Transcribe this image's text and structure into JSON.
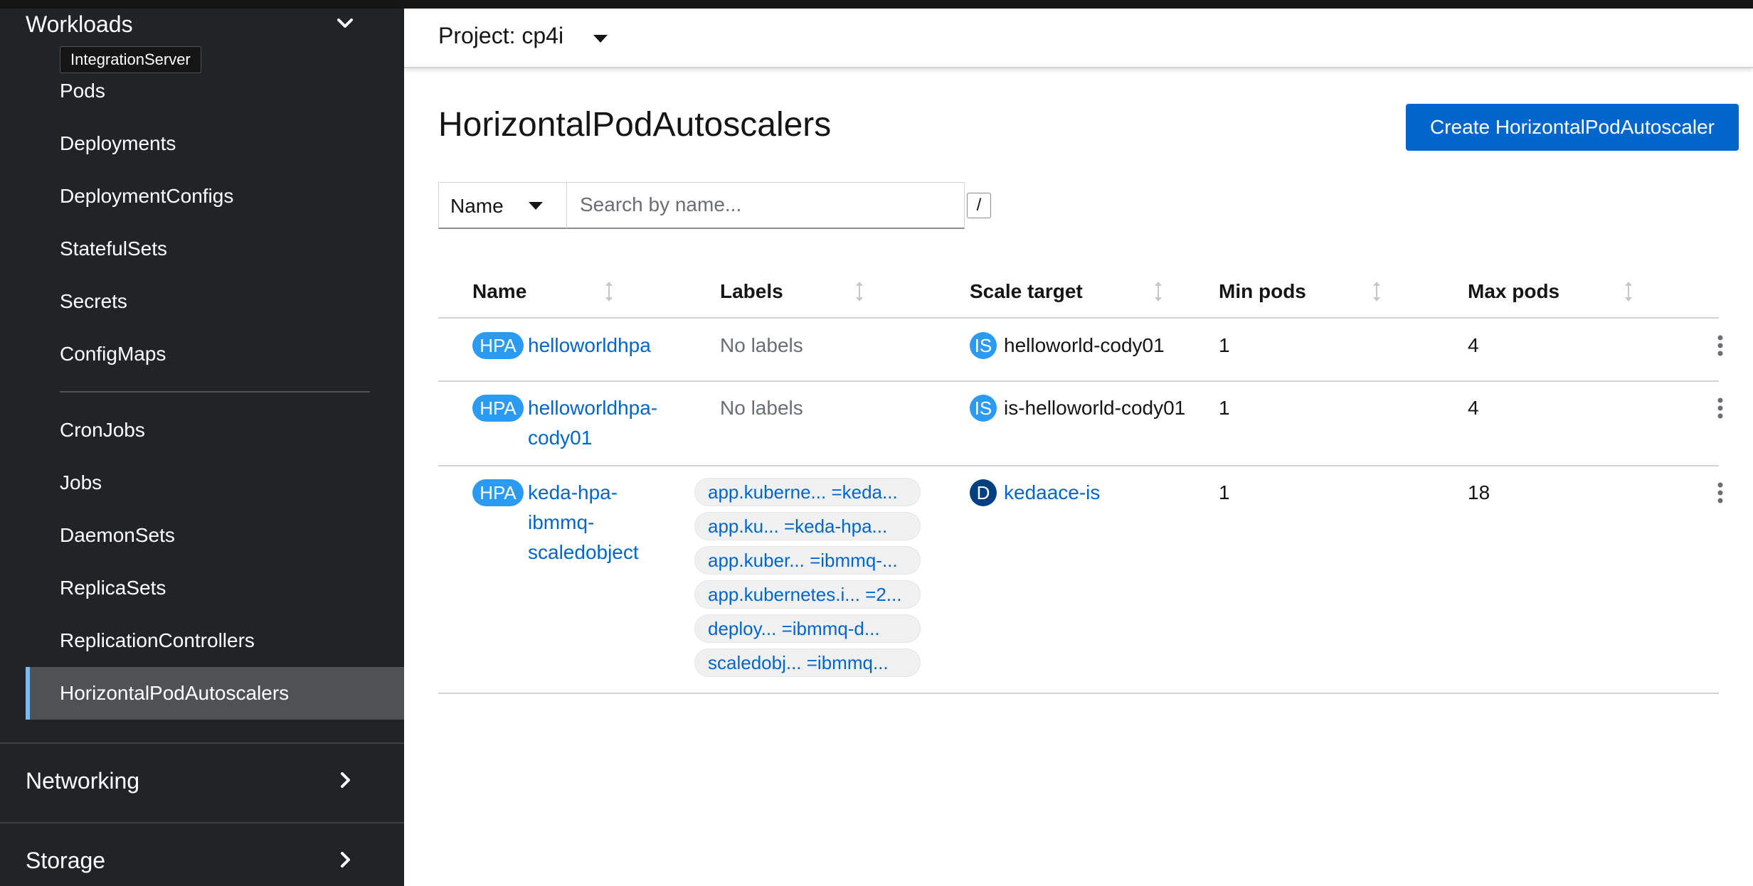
{
  "sidebar": {
    "workloads_title": "Workloads",
    "tooltip": "IntegrationServer",
    "items": [
      {
        "label": "Pods"
      },
      {
        "label": "Deployments"
      },
      {
        "label": "DeploymentConfigs"
      },
      {
        "label": "StatefulSets"
      },
      {
        "label": "Secrets"
      },
      {
        "label": "ConfigMaps"
      },
      {
        "label": "CronJobs"
      },
      {
        "label": "Jobs"
      },
      {
        "label": "DaemonSets"
      },
      {
        "label": "ReplicaSets"
      },
      {
        "label": "ReplicationControllers"
      },
      {
        "label": "HorizontalPodAutoscalers"
      }
    ],
    "networking_title": "Networking",
    "storage_title": "Storage"
  },
  "header": {
    "project_label": "Project: cp4i"
  },
  "page": {
    "title": "HorizontalPodAutoscalers",
    "create_button": "Create HorizontalPodAutoscaler",
    "filter_select": "Name",
    "search_placeholder": "Search by name...",
    "search_shortcut": "/"
  },
  "table": {
    "columns": [
      "Name",
      "Labels",
      "Scale target",
      "Min pods",
      "Max pods"
    ],
    "rows": [
      {
        "badge": "HPA",
        "name_lines": [
          "helloworldhpa"
        ],
        "labels_text": "No labels",
        "labels": [],
        "target_badge": "IS",
        "target": "helloworld-cody01",
        "min": "1",
        "max": "4"
      },
      {
        "badge": "HPA",
        "name_lines": [
          "helloworldhpa-",
          "cody01"
        ],
        "labels_text": "No labels",
        "labels": [],
        "target_badge": "IS",
        "target": "is-helloworld-cody01",
        "min": "1",
        "max": "4"
      },
      {
        "badge": "HPA",
        "name_lines": [
          "keda-hpa-",
          "ibmmq-",
          "scaledobject"
        ],
        "labels_text": "",
        "labels": [
          "app.kuberne... =keda...",
          "app.ku...   =keda-hpa...",
          "app.kuber... =ibmmq-...",
          "app.kubernetes.i... =2...",
          "deploy...   =ibmmq-d...",
          "scaledobj...  =ibmmq..."
        ],
        "target_badge": "D",
        "target": "kedaace-is",
        "min": "1",
        "max": "18"
      }
    ]
  },
  "colors": {
    "sidebar_bg": "#212427",
    "active_item_bg": "#4f5255",
    "active_accent": "#73bcf7",
    "link": "#0066cc",
    "primary_button": "#0066cc",
    "badge_blue": "#2b9af3",
    "badge_dark": "#004080"
  },
  "icons": [
    "chevron-down-icon",
    "chevron-right-icon",
    "caret-down-icon",
    "sort-icon",
    "kebab-icon"
  ]
}
